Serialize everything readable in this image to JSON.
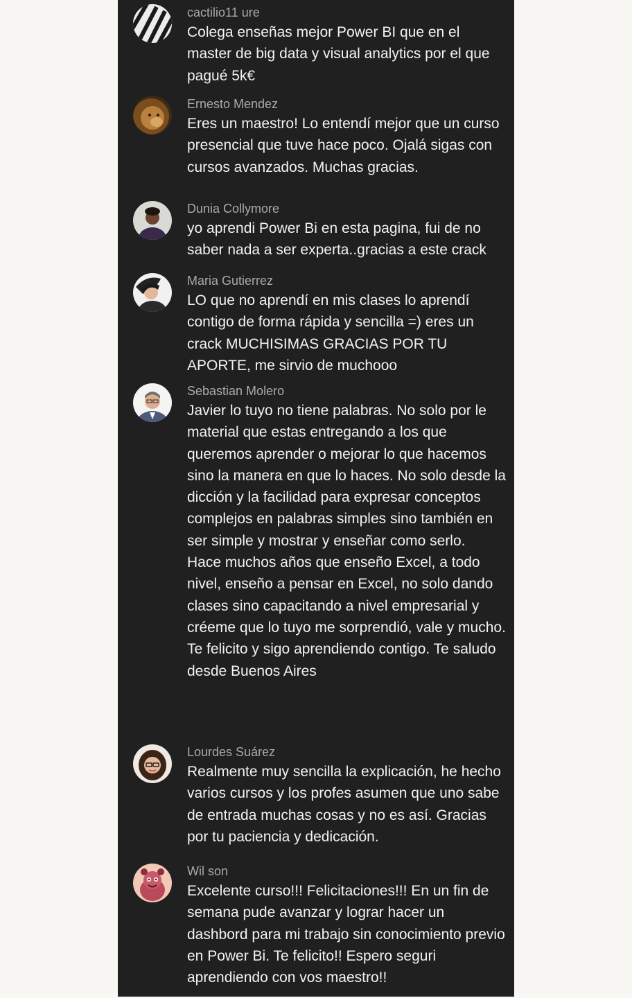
{
  "comments": [
    {
      "author": "cactilio11 ure",
      "avatar_icon": "striped-avatar-icon",
      "text": "Colega enseñas mejor Power BI que en el master de big data y visual analytics por el que pagué 5k€"
    },
    {
      "author": "Ernesto Mendez",
      "avatar_icon": "lion-avatar-icon",
      "text": "Eres un maestro! Lo entendí mejor que un curso presencial que tuve hace poco. Ojalá sigas con cursos avanzados. Muchas gracias."
    },
    {
      "author": "Dunia Collymore",
      "avatar_icon": "person-avatar-icon",
      "text": "yo aprendi Power Bi en esta pagina, fui de no saber nada a ser experta..gracias a este crack"
    },
    {
      "author": "Maria Gutierrez",
      "avatar_icon": "person-avatar-icon",
      "text": "LO que no aprendí en mis clases lo aprendí contigo de forma rápida y sencilla =) eres un crack MUCHISIMAS GRACIAS POR TU APORTE, me sirvio de muchooo"
    },
    {
      "author": "Sebastian Molero",
      "avatar_icon": "person-avatar-icon",
      "text": "Javier lo tuyo no tiene palabras. No solo por le material que estas entregando a los que queremos aprender o mejorar lo que hacemos sino la manera en que lo haces. No solo desde la dicción y la facilidad para expresar conceptos complejos en palabras simples sino también en ser simple y mostrar y enseñar como serlo.\nHace muchos años que enseño Excel, a todo nivel, enseño a pensar en Excel,  no solo dando clases sino capacitando a nivel empresarial y créeme que lo tuyo me sorprendió, vale y mucho.\nTe felicito y sigo aprendiendo contigo. Te saludo desde Buenos Aires"
    },
    {
      "author": "Lourdes Suárez",
      "avatar_icon": "person-avatar-icon",
      "text": "Realmente muy sencilla la explicación, he hecho varios cursos y los profes asumen que uno sabe de entrada muchas cosas y no es así. Gracias por tu paciencia y dedicación."
    },
    {
      "author": "Wil son",
      "avatar_icon": "cartoon-avatar-icon",
      "text": "Excelente curso!!! Felicitaciones!!! En un fin de semana pude avanzar y lograr hacer un dashbord para mi trabajo sin conocimiento previo en Power Bi. Te felicito!! Espero seguri aprendiendo con vos maestro!!"
    }
  ]
}
